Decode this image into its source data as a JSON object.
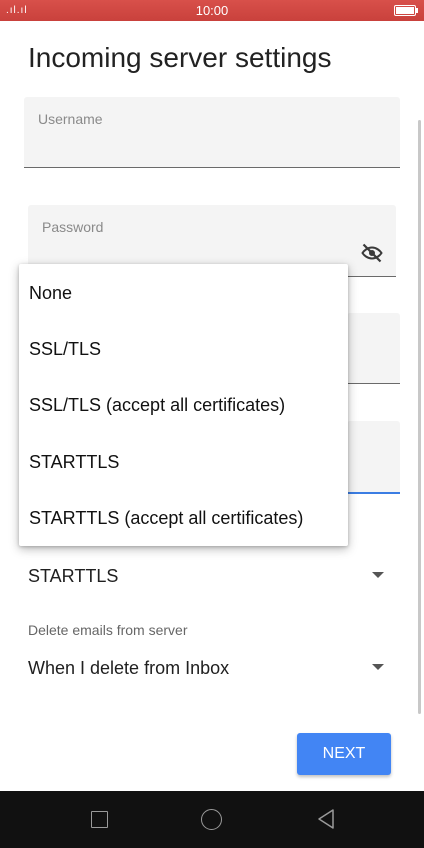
{
  "status_bar": {
    "time": "10:00",
    "signal": ".ıl.ıl"
  },
  "page": {
    "title": "Incoming server settings"
  },
  "username": {
    "label": "Username",
    "value": ""
  },
  "password": {
    "label": "Password",
    "value": "",
    "icon": "eye-off-icon"
  },
  "security_menu": {
    "options": [
      "None",
      "SSL/TLS",
      "SSL/TLS (accept all certificates)",
      "STARTTLS",
      "STARTTLS (accept all certificates)"
    ]
  },
  "security": {
    "selected": "STARTTLS"
  },
  "delete_emails": {
    "label": "Delete emails from server",
    "selected": "When I delete from Inbox"
  },
  "next_button": {
    "label": "NEXT"
  },
  "colors": {
    "status_bar": "#d9534f",
    "accent": "#4285f4",
    "nav_bar": "#111111"
  }
}
